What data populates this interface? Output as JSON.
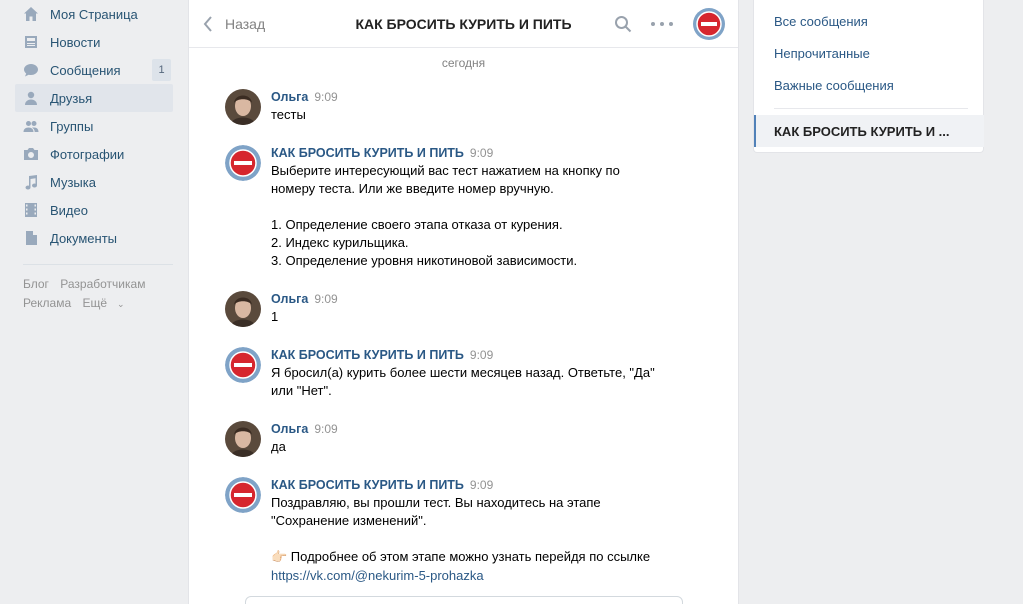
{
  "leftnav": {
    "items": [
      {
        "label": "Моя Страница",
        "icon": "home-icon"
      },
      {
        "label": "Новости",
        "icon": "news-icon"
      },
      {
        "label": "Сообщения",
        "icon": "messages-icon",
        "badge": "1"
      },
      {
        "label": "Друзья",
        "icon": "friends-icon"
      },
      {
        "label": "Группы",
        "icon": "groups-icon"
      },
      {
        "label": "Фотографии",
        "icon": "camera-icon"
      },
      {
        "label": "Музыка",
        "icon": "music-icon"
      },
      {
        "label": "Видео",
        "icon": "video-icon"
      },
      {
        "label": "Документы",
        "icon": "documents-icon"
      }
    ],
    "footer": {
      "blog": "Блог",
      "developers": "Разработчикам",
      "ads": "Реклама",
      "more": "Ещё"
    }
  },
  "chat": {
    "back_label": "Назад",
    "title": "КАК БРОСИТЬ КУРИТЬ И ПИТЬ",
    "day_label": "сегодня",
    "messages": [
      {
        "author": "Ольга",
        "time": "9:09",
        "text": "тесты"
      },
      {
        "author": "КАК БРОСИТЬ КУРИТЬ И ПИТЬ",
        "time": "9:09",
        "text": "Выберите интересующий вас тест нажатием на кнопку по номеру теста. Или же введите номер вручную.\n\n1. Определение своего этапа отказа от курения.\n2. Индекс курильщика.\n3. Определение уровня никотиновой зависимости."
      },
      {
        "author": "Ольга",
        "time": "9:09",
        "text": "1"
      },
      {
        "author": "КАК БРОСИТЬ КУРИТЬ И ПИТЬ",
        "time": "9:09",
        "text": "Я бросил(а) курить более шести месяцев назад. Ответьте, \"Да\" или \"Нет\"."
      },
      {
        "author": "Ольга",
        "time": "9:09",
        "text": "да"
      },
      {
        "author": "КАК БРОСИТЬ КУРИТЬ И ПИТЬ",
        "time": "9:09",
        "text": "Поздравляю, вы прошли тест. Вы находитесь на этапе \"Сохранение изменений\".",
        "text2": "👉🏻 Подробнее об этом этапе можно узнать перейдя по ссылке",
        "link": "https://vk.com/@nekurim-5-prohazka"
      }
    ]
  },
  "right": {
    "all": "Все сообщения",
    "unread": "Непрочитанные",
    "important": "Важные сообщения",
    "active_chat": "КАК БРОСИТЬ КУРИТЬ И ..."
  },
  "colors": {
    "accent": "#5181b8",
    "link": "#2a5885",
    "bg": "#edeef0"
  }
}
